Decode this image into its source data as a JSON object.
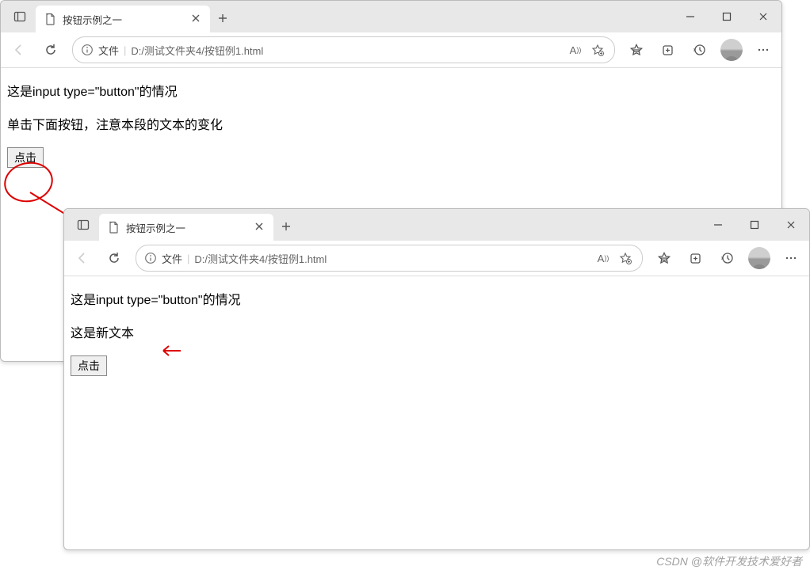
{
  "browser1": {
    "tabTitle": "按钮示例之一",
    "addrLabel": "文件",
    "addrPath": "D:/测试文件夹4/按钮例1.html",
    "content": {
      "line1": "这是input type=\"button\"的情况",
      "line2": "单击下面按钮，注意本段的文本的变化",
      "buttonLabel": "点击"
    }
  },
  "browser2": {
    "tabTitle": "按钮示例之一",
    "addrLabel": "文件",
    "addrPath": "D:/测试文件夹4/按钮例1.html",
    "content": {
      "line1": "这是input type=\"button\"的情况",
      "line2": "这是新文本",
      "buttonLabel": "点击"
    }
  },
  "watermark": "CSDN @软件开发技术爱好者"
}
